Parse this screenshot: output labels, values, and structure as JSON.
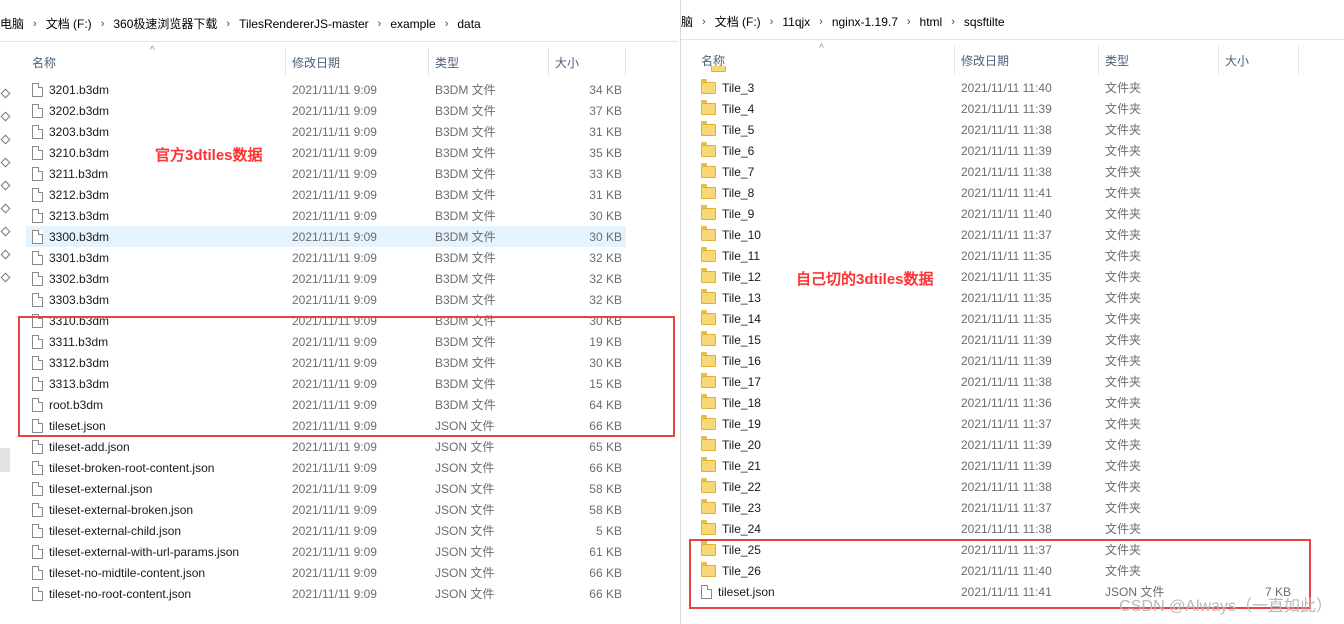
{
  "left": {
    "breadcrumb": [
      "电脑",
      "文档 (F:)",
      "360极速浏览器下载",
      "TilesRendererJS-master",
      "example",
      "data"
    ],
    "columns": {
      "name": "名称",
      "date": "修改日期",
      "type": "类型",
      "size": "大小"
    },
    "annotation": "官方3dtiles数据",
    "files": [
      {
        "name": "3201.b3dm",
        "date": "2021/11/11 9:09",
        "type": "B3DM 文件",
        "size": "34 KB"
      },
      {
        "name": "3202.b3dm",
        "date": "2021/11/11 9:09",
        "type": "B3DM 文件",
        "size": "37 KB"
      },
      {
        "name": "3203.b3dm",
        "date": "2021/11/11 9:09",
        "type": "B3DM 文件",
        "size": "31 KB"
      },
      {
        "name": "3210.b3dm",
        "date": "2021/11/11 9:09",
        "type": "B3DM 文件",
        "size": "35 KB"
      },
      {
        "name": "3211.b3dm",
        "date": "2021/11/11 9:09",
        "type": "B3DM 文件",
        "size": "33 KB"
      },
      {
        "name": "3212.b3dm",
        "date": "2021/11/11 9:09",
        "type": "B3DM 文件",
        "size": "31 KB"
      },
      {
        "name": "3213.b3dm",
        "date": "2021/11/11 9:09",
        "type": "B3DM 文件",
        "size": "30 KB"
      },
      {
        "name": "3300.b3dm",
        "date": "2021/11/11 9:09",
        "type": "B3DM 文件",
        "size": "30 KB",
        "selected": true
      },
      {
        "name": "3301.b3dm",
        "date": "2021/11/11 9:09",
        "type": "B3DM 文件",
        "size": "32 KB"
      },
      {
        "name": "3302.b3dm",
        "date": "2021/11/11 9:09",
        "type": "B3DM 文件",
        "size": "32 KB"
      },
      {
        "name": "3303.b3dm",
        "date": "2021/11/11 9:09",
        "type": "B3DM 文件",
        "size": "32 KB"
      },
      {
        "name": "3310.b3dm",
        "date": "2021/11/11 9:09",
        "type": "B3DM 文件",
        "size": "30 KB"
      },
      {
        "name": "3311.b3dm",
        "date": "2021/11/11 9:09",
        "type": "B3DM 文件",
        "size": "19 KB"
      },
      {
        "name": "3312.b3dm",
        "date": "2021/11/11 9:09",
        "type": "B3DM 文件",
        "size": "30 KB"
      },
      {
        "name": "3313.b3dm",
        "date": "2021/11/11 9:09",
        "type": "B3DM 文件",
        "size": "15 KB"
      },
      {
        "name": "root.b3dm",
        "date": "2021/11/11 9:09",
        "type": "B3DM 文件",
        "size": "64 KB"
      },
      {
        "name": "tileset.json",
        "date": "2021/11/11 9:09",
        "type": "JSON 文件",
        "size": "66 KB"
      },
      {
        "name": "tileset-add.json",
        "date": "2021/11/11 9:09",
        "type": "JSON 文件",
        "size": "65 KB"
      },
      {
        "name": "tileset-broken-root-content.json",
        "date": "2021/11/11 9:09",
        "type": "JSON 文件",
        "size": "66 KB"
      },
      {
        "name": "tileset-external.json",
        "date": "2021/11/11 9:09",
        "type": "JSON 文件",
        "size": "58 KB"
      },
      {
        "name": "tileset-external-broken.json",
        "date": "2021/11/11 9:09",
        "type": "JSON 文件",
        "size": "58 KB"
      },
      {
        "name": "tileset-external-child.json",
        "date": "2021/11/11 9:09",
        "type": "JSON 文件",
        "size": "5 KB"
      },
      {
        "name": "tileset-external-with-url-params.json",
        "date": "2021/11/11 9:09",
        "type": "JSON 文件",
        "size": "61 KB"
      },
      {
        "name": "tileset-no-midtile-content.json",
        "date": "2021/11/11 9:09",
        "type": "JSON 文件",
        "size": "66 KB"
      },
      {
        "name": "tileset-no-root-content.json",
        "date": "2021/11/11 9:09",
        "type": "JSON 文件",
        "size": "66 KB"
      }
    ]
  },
  "right": {
    "breadcrumb": [
      "脑",
      "文档 (F:)",
      "11qjx",
      "nginx-1.19.7",
      "html",
      "sqsftilte"
    ],
    "columns": {
      "name": "名称",
      "date": "修改日期",
      "type": "类型",
      "size": "大小"
    },
    "annotation": "自己切的3dtiles数据",
    "files": [
      {
        "name": "Tile_3",
        "date": "2021/11/11 11:40",
        "type": "文件夹",
        "size": "",
        "kind": "folder"
      },
      {
        "name": "Tile_4",
        "date": "2021/11/11 11:39",
        "type": "文件夹",
        "size": "",
        "kind": "folder"
      },
      {
        "name": "Tile_5",
        "date": "2021/11/11 11:38",
        "type": "文件夹",
        "size": "",
        "kind": "folder"
      },
      {
        "name": "Tile_6",
        "date": "2021/11/11 11:39",
        "type": "文件夹",
        "size": "",
        "kind": "folder"
      },
      {
        "name": "Tile_7",
        "date": "2021/11/11 11:38",
        "type": "文件夹",
        "size": "",
        "kind": "folder"
      },
      {
        "name": "Tile_8",
        "date": "2021/11/11 11:41",
        "type": "文件夹",
        "size": "",
        "kind": "folder"
      },
      {
        "name": "Tile_9",
        "date": "2021/11/11 11:40",
        "type": "文件夹",
        "size": "",
        "kind": "folder"
      },
      {
        "name": "Tile_10",
        "date": "2021/11/11 11:37",
        "type": "文件夹",
        "size": "",
        "kind": "folder"
      },
      {
        "name": "Tile_11",
        "date": "2021/11/11 11:35",
        "type": "文件夹",
        "size": "",
        "kind": "folder"
      },
      {
        "name": "Tile_12",
        "date": "2021/11/11 11:35",
        "type": "文件夹",
        "size": "",
        "kind": "folder"
      },
      {
        "name": "Tile_13",
        "date": "2021/11/11 11:35",
        "type": "文件夹",
        "size": "",
        "kind": "folder"
      },
      {
        "name": "Tile_14",
        "date": "2021/11/11 11:35",
        "type": "文件夹",
        "size": "",
        "kind": "folder"
      },
      {
        "name": "Tile_15",
        "date": "2021/11/11 11:39",
        "type": "文件夹",
        "size": "",
        "kind": "folder"
      },
      {
        "name": "Tile_16",
        "date": "2021/11/11 11:39",
        "type": "文件夹",
        "size": "",
        "kind": "folder"
      },
      {
        "name": "Tile_17",
        "date": "2021/11/11 11:38",
        "type": "文件夹",
        "size": "",
        "kind": "folder"
      },
      {
        "name": "Tile_18",
        "date": "2021/11/11 11:36",
        "type": "文件夹",
        "size": "",
        "kind": "folder"
      },
      {
        "name": "Tile_19",
        "date": "2021/11/11 11:37",
        "type": "文件夹",
        "size": "",
        "kind": "folder"
      },
      {
        "name": "Tile_20",
        "date": "2021/11/11 11:39",
        "type": "文件夹",
        "size": "",
        "kind": "folder"
      },
      {
        "name": "Tile_21",
        "date": "2021/11/11 11:39",
        "type": "文件夹",
        "size": "",
        "kind": "folder"
      },
      {
        "name": "Tile_22",
        "date": "2021/11/11 11:38",
        "type": "文件夹",
        "size": "",
        "kind": "folder"
      },
      {
        "name": "Tile_23",
        "date": "2021/11/11 11:37",
        "type": "文件夹",
        "size": "",
        "kind": "folder"
      },
      {
        "name": "Tile_24",
        "date": "2021/11/11 11:38",
        "type": "文件夹",
        "size": "",
        "kind": "folder"
      },
      {
        "name": "Tile_25",
        "date": "2021/11/11 11:37",
        "type": "文件夹",
        "size": "",
        "kind": "folder"
      },
      {
        "name": "Tile_26",
        "date": "2021/11/11 11:40",
        "type": "文件夹",
        "size": "",
        "kind": "folder"
      },
      {
        "name": "tileset.json",
        "date": "2021/11/11 11:41",
        "type": "JSON 文件",
        "size": "7 KB",
        "kind": "file"
      }
    ]
  },
  "watermark": "CSDN @Always（一直如此）"
}
